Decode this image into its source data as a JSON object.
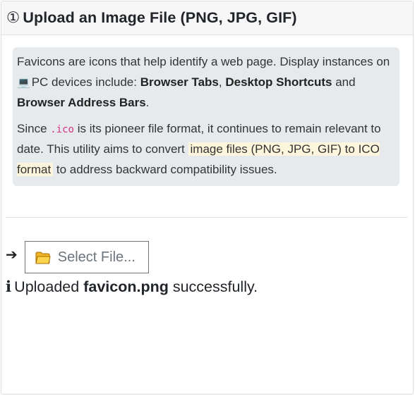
{
  "header": {
    "step": "①",
    "title": "Upload an Image File (PNG, JPG, GIF)"
  },
  "info": {
    "p1_prefix": "Favicons are icons that help identify a web page. Display instances on ",
    "device_icon": "laptop-icon",
    "p1_device": "PC devices include: ",
    "item1": "Browser Tabs",
    "sep1": ", ",
    "item2": "Desktop Shortcuts",
    "sep2": " and ",
    "item3": "Browser Address Bars",
    "end": ".",
    "p2_since": "Since ",
    "p2_code": ".ico",
    "p2_mid": " is its pioneer file format, it continues to remain relevant to date. This utility aims to convert ",
    "p2_highlight": "image files (PNG, JPG, GIF) to ICO format",
    "p2_end": " to address backward compatibility issues."
  },
  "upload": {
    "arrow_icon": "arrow-right-icon",
    "folder_icon": "folder-icon",
    "button_label": "Select File..."
  },
  "status": {
    "icon": "info-icon",
    "prefix": "Uploaded ",
    "filename": "favicon.png",
    "suffix": " successfully."
  },
  "colors": {
    "info_bg": "#e7eaed",
    "code": "#d63384",
    "highlight": "#fdf6dc",
    "button_text": "#6c757d"
  }
}
